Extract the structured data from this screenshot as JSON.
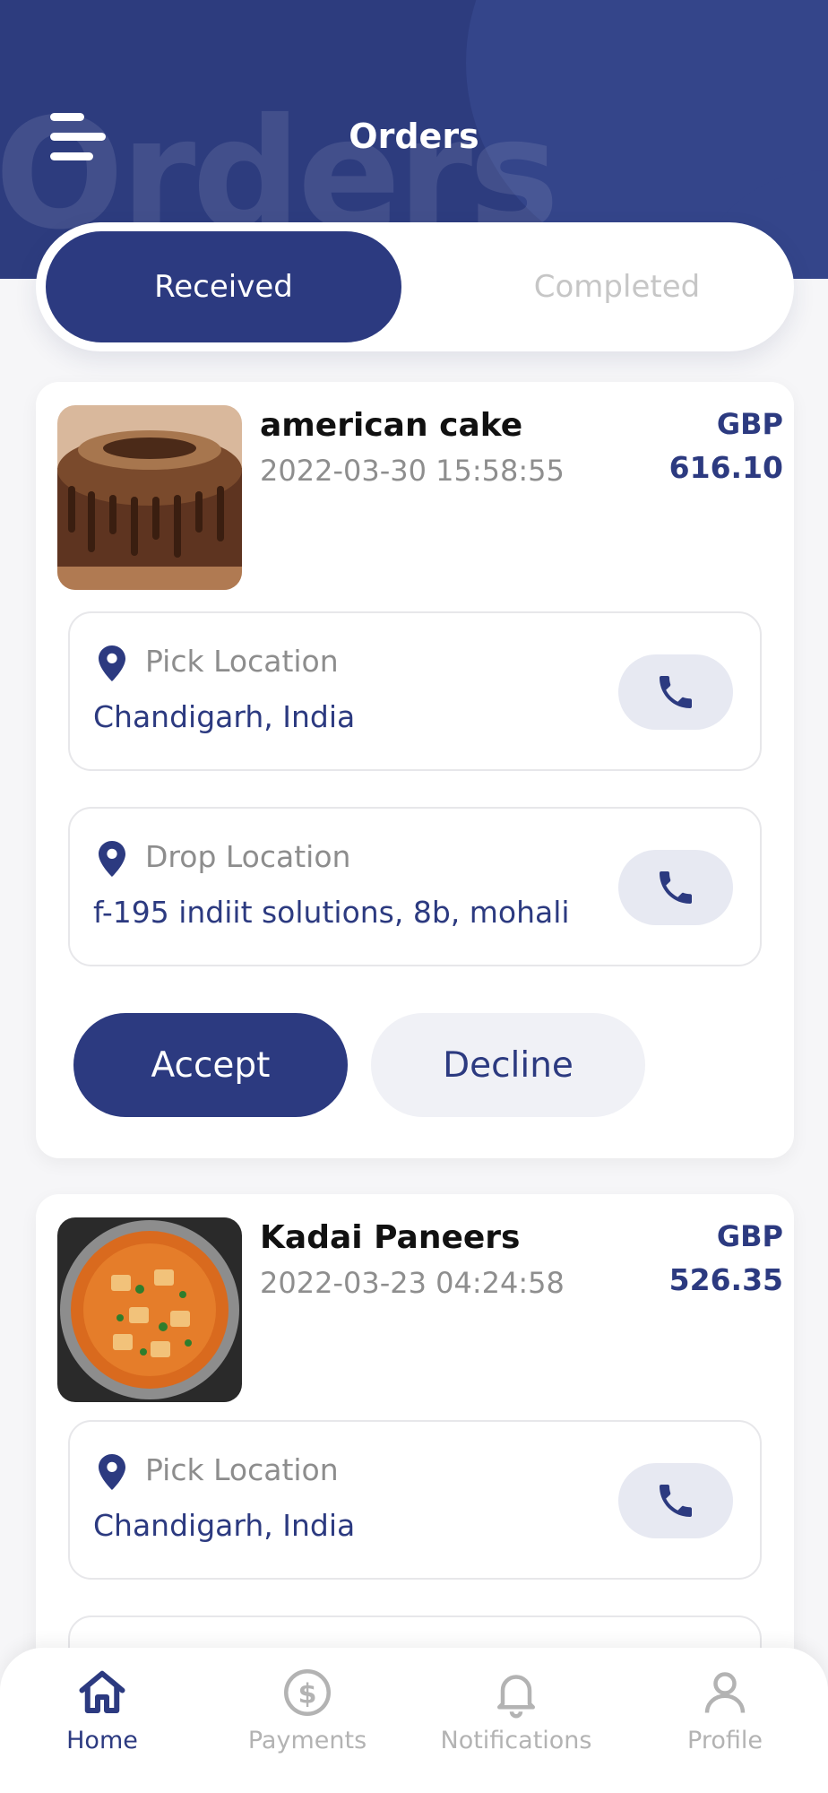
{
  "header": {
    "title": "Orders",
    "watermark": "Orders"
  },
  "tabs": [
    {
      "label": "Received",
      "active": true
    },
    {
      "label": "Completed",
      "active": false
    }
  ],
  "orders": [
    {
      "name": "american cake",
      "datetime": "2022-03-30 15:58:55",
      "currency": "GBP",
      "amount": "616.10",
      "pick": {
        "label": "Pick Location",
        "value": "Chandigarh, India"
      },
      "drop": {
        "label": "Drop Location",
        "value": "f-195 indiit solutions, 8b, mohali"
      },
      "accept_label": "Accept",
      "decline_label": "Decline"
    },
    {
      "name": "Kadai Paneers",
      "datetime": "2022-03-23 04:24:58",
      "currency": "GBP",
      "amount": "526.35",
      "pick": {
        "label": "Pick Location",
        "value": "Chandigarh, India"
      }
    }
  ],
  "nav": [
    {
      "label": "Home",
      "icon": "home-icon",
      "active": true
    },
    {
      "label": "Payments",
      "icon": "dollar-circle-icon",
      "active": false
    },
    {
      "label": "Notifications",
      "icon": "bell-icon",
      "active": false
    },
    {
      "label": "Profile",
      "icon": "user-icon",
      "active": false
    }
  ],
  "colors": {
    "primary": "#2c3a80",
    "header": "#2d3c7e",
    "muted": "#8e8e8e"
  }
}
